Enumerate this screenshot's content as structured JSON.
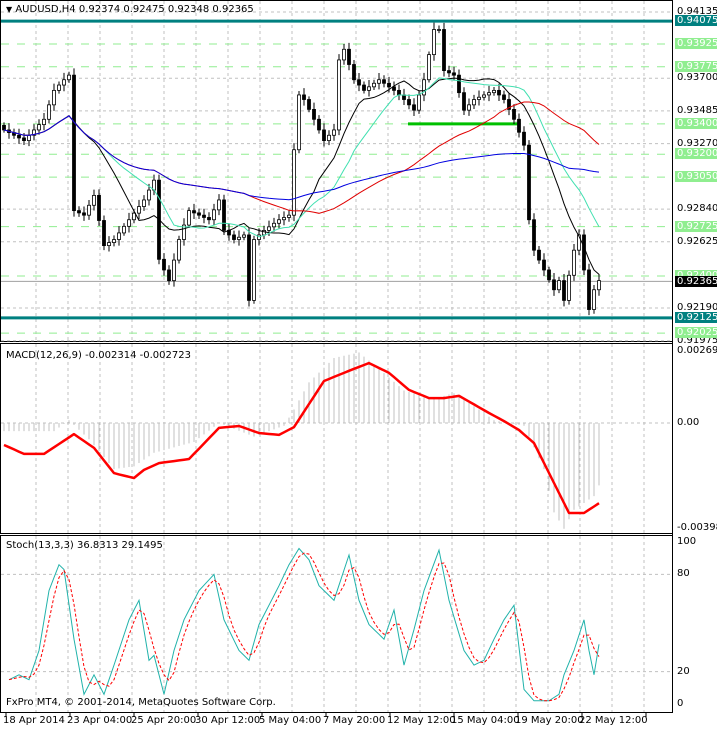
{
  "header": {
    "arrow": "▼",
    "symbol": "AUDUSD,H4",
    "ohlc": "0.92374 0.92475 0.92348 0.92365"
  },
  "footer": "FxPro MT4, © 2001-2014, MetaQuotes Software Corp.",
  "colors": {
    "teal": "#008080",
    "green": "#90ee90",
    "brightGreen": "#00c000",
    "ma1": "#000000",
    "ma2": "#40e0b0",
    "ma3": "#e00000",
    "ma4": "#0000e0",
    "macd": "#ff0000",
    "hist": "#c0c0c0",
    "stochMain": "#20b2aa",
    "stochSignal": "#ff0000"
  },
  "chart_data": [
    {
      "type": "candlestick",
      "title": "AUDUSD,H4",
      "ylim": [
        0.91975,
        0.94135
      ],
      "price_ticks": [
        "0.94135",
        "0.93700",
        "0.93485",
        "0.93270",
        "0.92840",
        "0.92625",
        "0.92190",
        "0.91975"
      ],
      "current_price": "0.92365",
      "teal_levels": [
        {
          "value": 0.94075,
          "label": "0.94075"
        },
        {
          "value": 0.92125,
          "label": "0.92125"
        }
      ],
      "green_levels": [
        {
          "value": 0.93925,
          "label": "0.93925"
        },
        {
          "value": 0.93775,
          "label": "0.93775"
        },
        {
          "value": 0.934,
          "label": "0.93400"
        },
        {
          "value": 0.932,
          "label": "0.93200"
        },
        {
          "value": 0.9305,
          "label": "0.93050"
        },
        {
          "value": 0.92725,
          "label": "0.92725"
        },
        {
          "value": 0.924,
          "label": "0.92400"
        },
        {
          "value": 0.92025,
          "label": "0.92025"
        }
      ],
      "bars": 120,
      "close_keyframes": [
        [
          0,
          0.9336
        ],
        [
          4,
          0.9329
        ],
        [
          8,
          0.9343
        ],
        [
          10,
          0.9362
        ],
        [
          12,
          0.9369
        ],
        [
          13,
          0.9372
        ],
        [
          14,
          0.9283
        ],
        [
          16,
          0.928
        ],
        [
          18,
          0.9293
        ],
        [
          20,
          0.926
        ],
        [
          22,
          0.9264
        ],
        [
          25,
          0.9277
        ],
        [
          28,
          0.929
        ],
        [
          30,
          0.9303
        ],
        [
          31,
          0.9251
        ],
        [
          33,
          0.9237
        ],
        [
          35,
          0.9264
        ],
        [
          37,
          0.9283
        ],
        [
          39,
          0.928
        ],
        [
          41,
          0.9277
        ],
        [
          43,
          0.929
        ],
        [
          44,
          0.927
        ],
        [
          46,
          0.9264
        ],
        [
          48,
          0.9267
        ],
        [
          49,
          0.9224
        ],
        [
          50,
          0.9264
        ],
        [
          52,
          0.927
        ],
        [
          55,
          0.9277
        ],
        [
          57,
          0.928
        ],
        [
          58,
          0.9323
        ],
        [
          59,
          0.9359
        ],
        [
          60,
          0.9356
        ],
        [
          62,
          0.9343
        ],
        [
          64,
          0.9329
        ],
        [
          66,
          0.9336
        ],
        [
          67,
          0.9382
        ],
        [
          68,
          0.9389
        ],
        [
          70,
          0.9369
        ],
        [
          72,
          0.9362
        ],
        [
          75,
          0.9369
        ],
        [
          78,
          0.9362
        ],
        [
          80,
          0.9356
        ],
        [
          82,
          0.9349
        ],
        [
          84,
          0.9369
        ],
        [
          86,
          0.9402
        ],
        [
          87,
          0.9402
        ],
        [
          88,
          0.9375
        ],
        [
          90,
          0.9372
        ],
        [
          92,
          0.9349
        ],
        [
          94,
          0.9356
        ],
        [
          96,
          0.9359
        ],
        [
          98,
          0.9362
        ],
        [
          100,
          0.9356
        ],
        [
          102,
          0.9343
        ],
        [
          104,
          0.9326
        ],
        [
          105,
          0.9277
        ],
        [
          106,
          0.9257
        ],
        [
          108,
          0.9244
        ],
        [
          110,
          0.9231
        ],
        [
          111,
          0.9237
        ],
        [
          112,
          0.9224
        ],
        [
          114,
          0.9257
        ],
        [
          115,
          0.9267
        ],
        [
          116,
          0.9244
        ],
        [
          117,
          0.9218
        ],
        [
          118,
          0.9231
        ],
        [
          119,
          0.9237
        ]
      ],
      "moving_averages": [
        {
          "period": 14,
          "color": "ma1"
        },
        {
          "period": 21,
          "color": "ma2"
        },
        {
          "period": 50,
          "color": "ma3"
        },
        {
          "period": 100,
          "color": "ma4"
        }
      ]
    },
    {
      "type": "line",
      "title": "MACD(12,26,9) -0.002314 -0.002723",
      "ylim": [
        -0.003984,
        0.002693
      ],
      "ticks": [
        "0.002693",
        "0.00",
        "-0.003984"
      ],
      "signal_keyframes": [
        [
          0,
          -0.00081
        ],
        [
          4,
          -0.00114
        ],
        [
          8,
          -0.00114
        ],
        [
          14,
          -0.00041
        ],
        [
          18,
          -0.00092
        ],
        [
          22,
          -0.00185
        ],
        [
          26,
          -0.00203
        ],
        [
          28,
          -0.00173
        ],
        [
          31,
          -0.00148
        ],
        [
          37,
          -0.00133
        ],
        [
          43,
          -0.00018
        ],
        [
          47,
          -0.00011
        ],
        [
          51,
          -0.00037
        ],
        [
          55,
          -0.00044
        ],
        [
          58,
          -0.00015
        ],
        [
          64,
          0.00155
        ],
        [
          70,
          0.002
        ],
        [
          73,
          0.00221
        ],
        [
          77,
          0.00185
        ],
        [
          81,
          0.00122
        ],
        [
          85,
          0.00092
        ],
        [
          88,
          0.00092
        ],
        [
          91,
          0.001
        ],
        [
          97,
          0.00037
        ],
        [
          100,
          7e-05
        ],
        [
          103,
          -0.00026
        ],
        [
          106,
          -0.00074
        ],
        [
          113,
          -0.00332
        ],
        [
          116,
          -0.00332
        ],
        [
          120,
          -0.00284
        ]
      ],
      "hist_keyframes": [
        [
          0,
          -0.0003
        ],
        [
          10,
          -0.0003
        ],
        [
          13,
          0.0001
        ],
        [
          17,
          -0.0006
        ],
        [
          22,
          -0.0017
        ],
        [
          26,
          -0.0016
        ],
        [
          30,
          -0.0011
        ],
        [
          38,
          -0.0007
        ],
        [
          43,
          0
        ],
        [
          50,
          -0.0005
        ],
        [
          56,
          -0.0001
        ],
        [
          58,
          0.0005
        ],
        [
          61,
          0.0015
        ],
        [
          66,
          0.0024
        ],
        [
          71,
          0.0026
        ],
        [
          75,
          0.002
        ],
        [
          80,
          0.0012
        ],
        [
          86,
          0.0009
        ],
        [
          90,
          0.0011
        ],
        [
          95,
          0.0005
        ],
        [
          98,
          0.0001
        ],
        [
          104,
          -0.0001
        ],
        [
          108,
          -0.0017
        ],
        [
          110,
          -0.0033
        ],
        [
          112,
          -0.0039
        ],
        [
          114,
          -0.0032
        ],
        [
          118,
          -0.0027
        ],
        [
          119,
          -0.0023
        ]
      ]
    },
    {
      "type": "line",
      "title": "Stoch(13,3,3) 36.8313 29.1495",
      "ylim": [
        0,
        100
      ],
      "ticks": [
        "100",
        "80",
        "20",
        "0"
      ],
      "main_keyframes": [
        [
          1,
          15
        ],
        [
          3,
          18
        ],
        [
          5,
          15
        ],
        [
          7,
          33
        ],
        [
          9,
          70
        ],
        [
          11,
          86
        ],
        [
          12,
          83
        ],
        [
          14,
          40
        ],
        [
          16,
          6
        ],
        [
          18,
          18
        ],
        [
          20,
          6
        ],
        [
          22,
          24
        ],
        [
          25,
          52
        ],
        [
          27,
          64
        ],
        [
          29,
          27
        ],
        [
          30,
          30
        ],
        [
          32,
          6
        ],
        [
          34,
          33
        ],
        [
          36,
          52
        ],
        [
          39,
          70
        ],
        [
          42,
          80
        ],
        [
          44,
          52
        ],
        [
          47,
          33
        ],
        [
          49,
          27
        ],
        [
          51,
          49
        ],
        [
          53,
          61
        ],
        [
          55,
          73
        ],
        [
          57,
          86
        ],
        [
          59,
          96
        ],
        [
          61,
          89
        ],
        [
          63,
          73
        ],
        [
          66,
          64
        ],
        [
          69,
          92
        ],
        [
          71,
          64
        ],
        [
          73,
          49
        ],
        [
          76,
          40
        ],
        [
          78,
          58
        ],
        [
          80,
          24
        ],
        [
          82,
          46
        ],
        [
          84,
          70
        ],
        [
          87,
          95
        ],
        [
          89,
          64
        ],
        [
          92,
          33
        ],
        [
          94,
          24
        ],
        [
          96,
          27
        ],
        [
          98,
          40
        ],
        [
          100,
          52
        ],
        [
          102,
          61
        ],
        [
          104,
          9
        ],
        [
          106,
          2
        ],
        [
          109,
          2
        ],
        [
          111,
          6
        ],
        [
          112,
          18
        ],
        [
          114,
          33
        ],
        [
          116,
          52
        ],
        [
          117,
          33
        ],
        [
          118,
          18
        ],
        [
          119,
          36.83
        ]
      ]
    },
    {
      "type": "axis",
      "time_labels": [
        "18 Apr 2014",
        "23 Apr 04:00",
        "25 Apr 20:00",
        "30 Apr 12:00",
        "5 May 04:00",
        "7 May 20:00",
        "12 May 12:00",
        "15 May 04:00",
        "19 May 20:00",
        "22 May 12:00"
      ]
    }
  ]
}
